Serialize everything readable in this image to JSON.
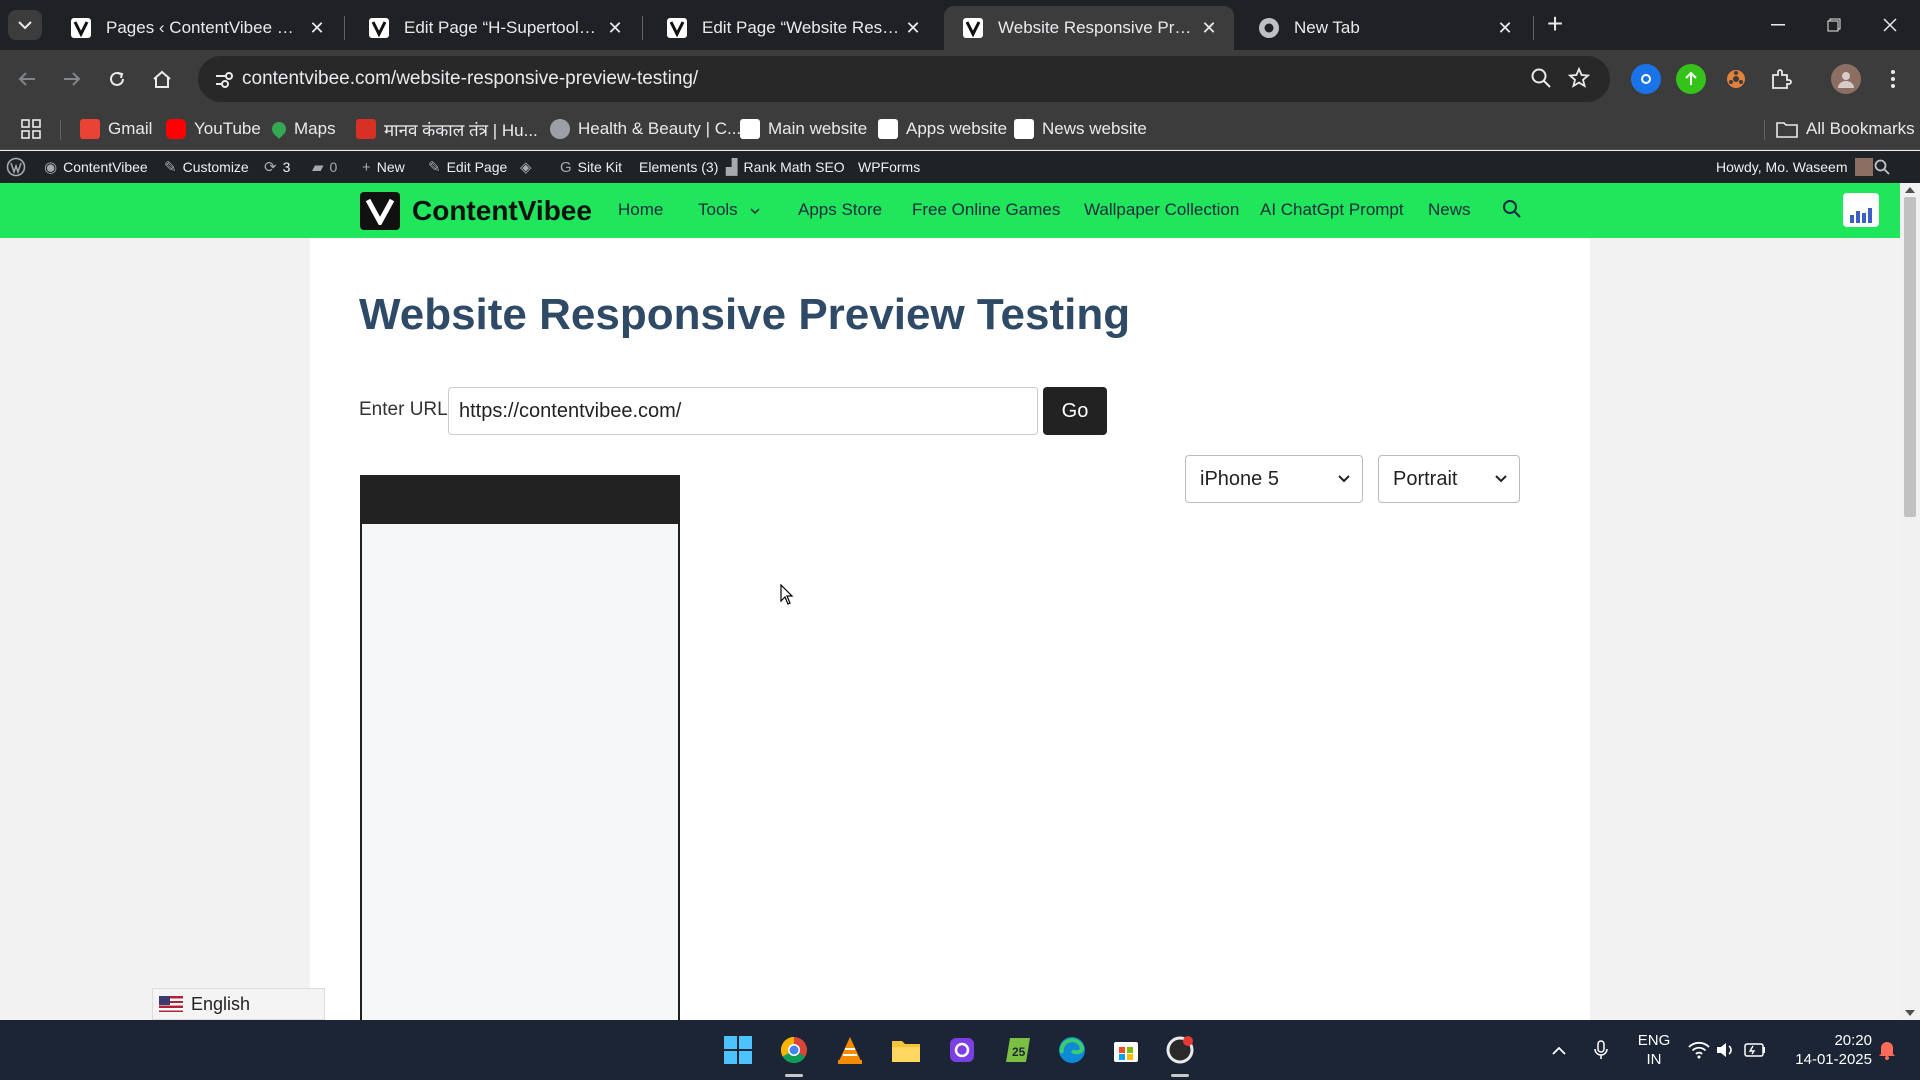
{
  "browser": {
    "tabs": [
      {
        "title": "Pages ‹ ContentVibee — WordPress",
        "active": false
      },
      {
        "title": "Edit Page “H-Supertools” ‹ ContentVibee",
        "active": false
      },
      {
        "title": "Edit Page “Website Responsive Preview",
        "active": false
      },
      {
        "title": "Website Responsive Preview Testing",
        "active": true
      },
      {
        "title": "New Tab",
        "active": false
      }
    ],
    "url": "contentvibee.com/website-responsive-preview-testing/",
    "bookmarks": [
      {
        "label": "Gmail",
        "icon": "gmail-icon",
        "color": "#ea4335"
      },
      {
        "label": "YouTube",
        "icon": "youtube-icon",
        "color": "#ff0000"
      },
      {
        "label": "Maps",
        "icon": "maps-icon",
        "color": "#34a853"
      },
      {
        "label": "मानव कंकाल तंत्र | Hu...",
        "icon": "site-icon",
        "color": "#d93025"
      },
      {
        "label": "Health & Beauty | C...",
        "icon": "globe-icon",
        "color": "#9aa0a6"
      },
      {
        "label": "Main website",
        "icon": "contentvibee-icon",
        "color": "#ffffff"
      },
      {
        "label": "Apps website",
        "icon": "apps-icon",
        "color": "#ffffff"
      },
      {
        "label": "News website",
        "icon": "news-icon",
        "color": "#ffffff"
      }
    ],
    "all_bookmarks": "All Bookmarks"
  },
  "wp_admin_bar": {
    "site": "ContentVibee",
    "customize": "Customize",
    "updates": "3",
    "comments": "0",
    "new": "New",
    "edit_page": "Edit Page",
    "site_kit": "Site Kit",
    "elements": "Elements (3)",
    "rank_math": "Rank Math SEO",
    "wpforms": "WPForms",
    "howdy": "Howdy, Mo. Waseem"
  },
  "site": {
    "brand": "ContentVibee",
    "brand_color": "#1fe65a",
    "menu": [
      "Home",
      "Tools",
      "Apps Store",
      "Free Online Games",
      "Wallpaper Collection",
      "AI ChatGpt Prompt",
      "News"
    ]
  },
  "page": {
    "title": "Website Responsive Preview Testing",
    "url_label": "Enter URL:",
    "url_value": "https://contentvibee.com/",
    "go_label": "Go",
    "device_selected": "iPhone 5",
    "orientation_selected": "Portrait",
    "language": "English"
  },
  "taskbar": {
    "lang_top": "ENG",
    "lang_bottom": "IN",
    "time": "20:20",
    "date": "14-01-2025"
  }
}
